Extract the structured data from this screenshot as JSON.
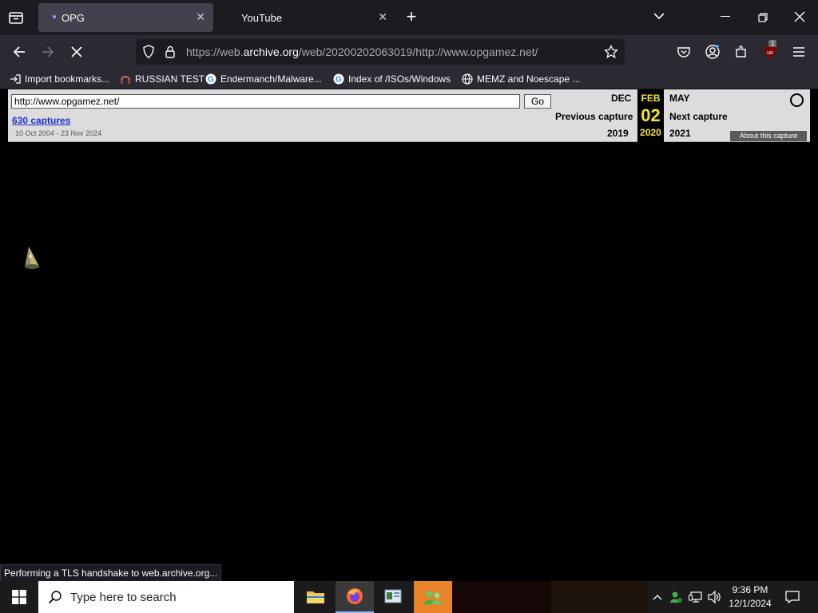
{
  "browser": {
    "tabs": [
      {
        "label": "OPG",
        "active": true
      },
      {
        "label": "YouTube",
        "active": false
      }
    ],
    "url": {
      "scheme": "https://web.",
      "domain": "archive.org",
      "path": "/web/20200202063019/http://www.opgamez.net/"
    },
    "bookmarks": [
      {
        "label": "Import bookmarks...",
        "icon": "import-icon"
      },
      {
        "label": "RUSSIAN TEST",
        "icon": "headset-icon"
      },
      {
        "label": "Endermanch/Malware...",
        "icon": "google-icon"
      },
      {
        "label": "Index of /ISOs/Windows",
        "icon": "google-icon"
      },
      {
        "label": "MEMZ and Noescape ...",
        "icon": "globe-icon"
      }
    ],
    "extension_badge": "1",
    "status_text": "Performing a TLS handshake to web.archive.org..."
  },
  "wayback": {
    "url_value": "http://www.opgamez.net/",
    "go_label": "Go",
    "captures_label": "630 captures",
    "range_label": "10 Oct 2004 - 23 Nov 2024",
    "prev_month": "DEC",
    "prev_label": "Previous capture",
    "prev_year": "2019",
    "cur_month": "FEB",
    "cur_day": "02",
    "cur_year": "2020",
    "next_month": "MAY",
    "next_label": "Next capture",
    "next_year": "2021",
    "about_label": "About this capture"
  },
  "taskbar": {
    "search_placeholder": "Type here to search",
    "time": "9:36 PM",
    "date": "12/1/2024"
  },
  "colors": {
    "highlight_yellow": "#f4e72a",
    "captures_link": "#1a31c8",
    "taskbar_active": "#e8832a"
  }
}
